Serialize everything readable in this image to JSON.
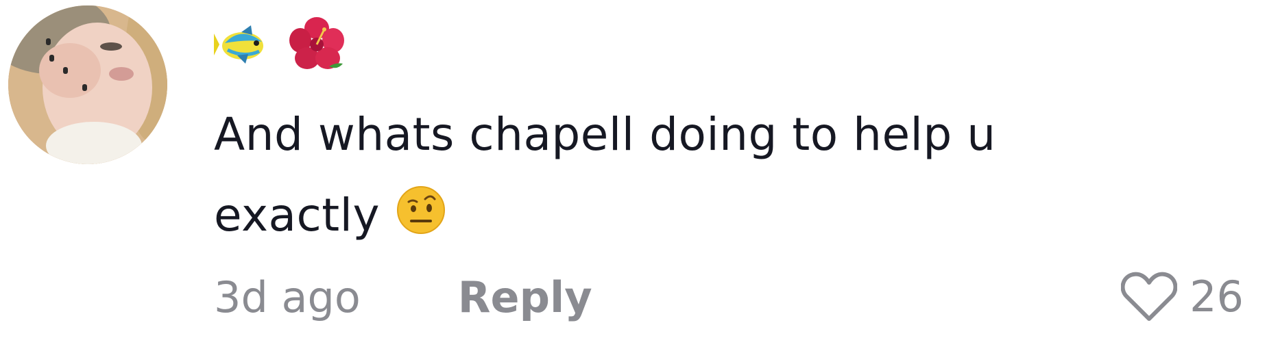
{
  "comment": {
    "username_emojis": [
      "tropical-fish-emoji",
      "hibiscus-emoji"
    ],
    "text_line1": "And whats chapell doing to help u",
    "text_line2": "exactly",
    "inline_emoji": "face-with-raised-eyebrow-emoji",
    "timestamp": "3d ago",
    "reply_label": "Reply",
    "like_count": "26"
  },
  "colors": {
    "text": "#161823",
    "meta": "#8a8b91",
    "background": "#ffffff"
  }
}
